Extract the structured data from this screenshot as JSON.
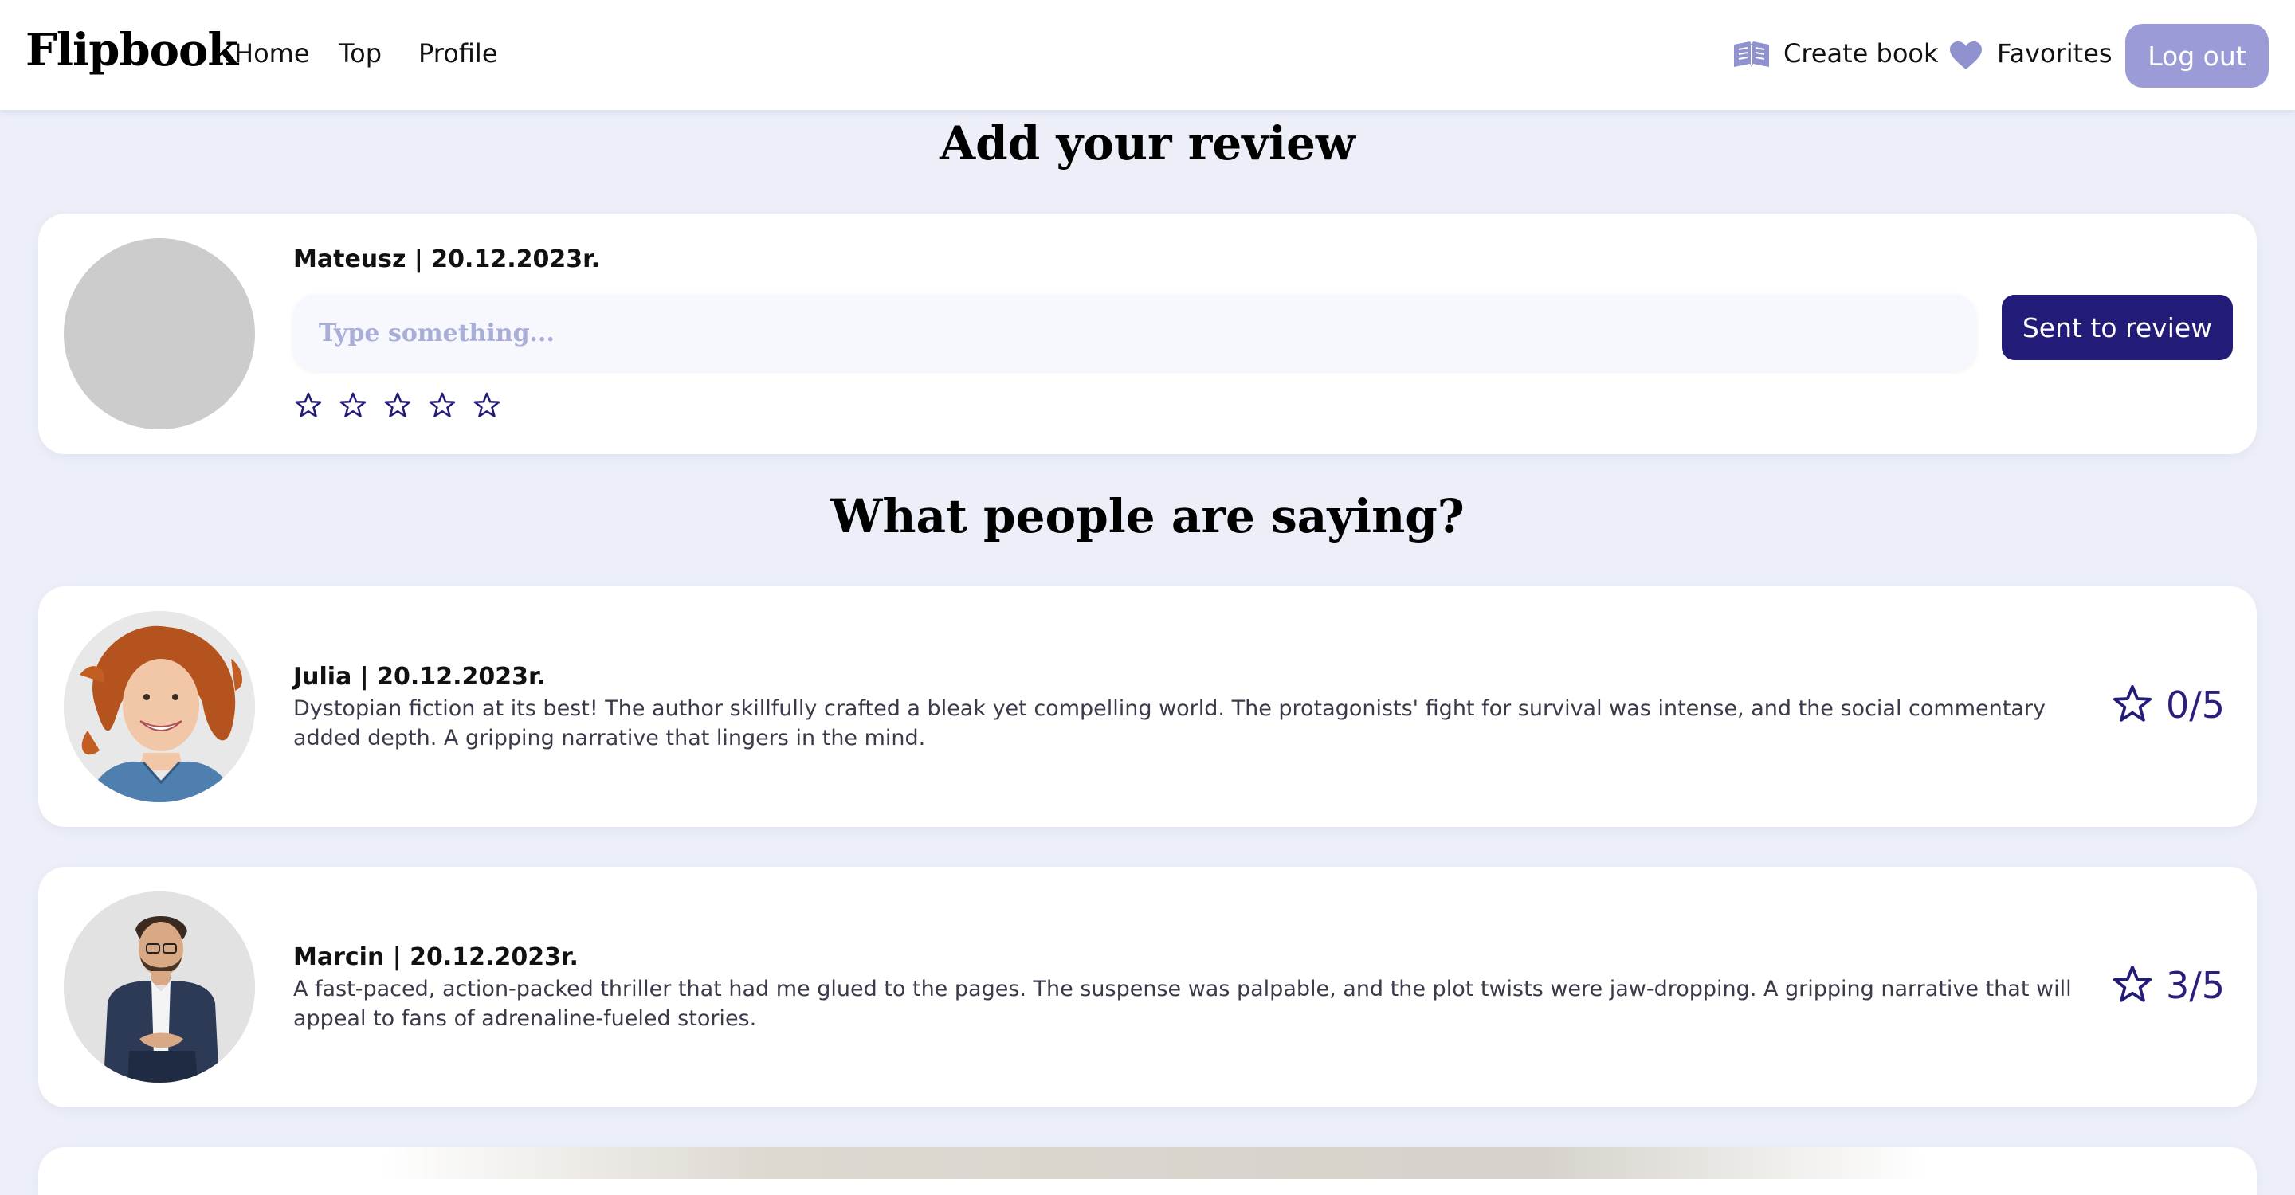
{
  "nav": {
    "logo": "Flipbook",
    "links": [
      {
        "label": "Home"
      },
      {
        "label": "Top"
      },
      {
        "label": "Profile"
      }
    ],
    "create_book": "Create book",
    "favorites": "Favorites",
    "logout": "Log out"
  },
  "add_review": {
    "title": "Add your review",
    "author_line": "Mateusz | 20.12.2023r.",
    "input_placeholder": "Type something...",
    "input_value": "",
    "stars_total": 5,
    "stars_selected": 0,
    "submit_label": "Sent to review"
  },
  "reviews_section": {
    "title": "What people are saying?",
    "reviews": [
      {
        "author_line": "Julia | 20.12.2023r.",
        "text": "Dystopian fiction at its best! The author skillfully crafted a bleak yet compelling world. The protagonists' fight for survival was intense, and the social commentary added depth. A gripping narrative that lingers in the mind.",
        "rating": "0/5"
      },
      {
        "author_line": "Marcin | 20.12.2023r.",
        "text": "A fast-paced, action-packed thriller that had me glued to the pages. The suspense was palpable, and the plot twists were jaw-dropping. A gripping narrative that will appeal to fans of adrenaline-fueled stories.",
        "rating": "3/5"
      }
    ]
  },
  "colors": {
    "accent_dark": "#231b78",
    "accent_light": "#9b9bd8",
    "background": "#eceff8"
  }
}
